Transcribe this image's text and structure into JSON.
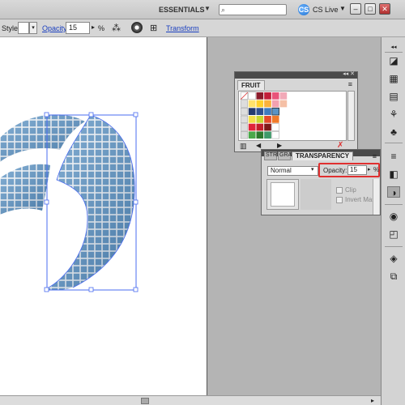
{
  "appbar": {
    "workspace": "ESSENTIALS",
    "dropdown_arrow": "▼",
    "search_placeholder": "",
    "cslive": "CS Live",
    "cslive_icon": "CS",
    "minimize": "–",
    "restore": "□",
    "close": "✕"
  },
  "controlbar": {
    "style_label": "Style:",
    "opacity_label": "Opacity:",
    "opacity_value": "15",
    "opacity_arrow": "▸",
    "percent": "%",
    "transform_label": "Transform",
    "style_arrow": "▾"
  },
  "fruit_panel": {
    "title": "FRUIT",
    "top_buttons": "◂◂ ✕",
    "menu": "≡"
  },
  "transparency_panel": {
    "tab_stroke": "STR",
    "tab_gradient": "GRA",
    "tab_transparency": "TRANSPARENCY",
    "menu": "≡",
    "blend_mode": "Normal",
    "blend_arrow": "▾",
    "opacity_label": "Opacity:",
    "opacity_value": "15",
    "opacity_arrow": "▸",
    "percent": "%",
    "clip_label": "Clip",
    "invert_label": "Invert Mask"
  },
  "colors": {
    "accent_link": "#1a3fc0",
    "highlight": "#e03030",
    "selection": "#4a6cf0",
    "art_blue": "#4f88b8"
  }
}
